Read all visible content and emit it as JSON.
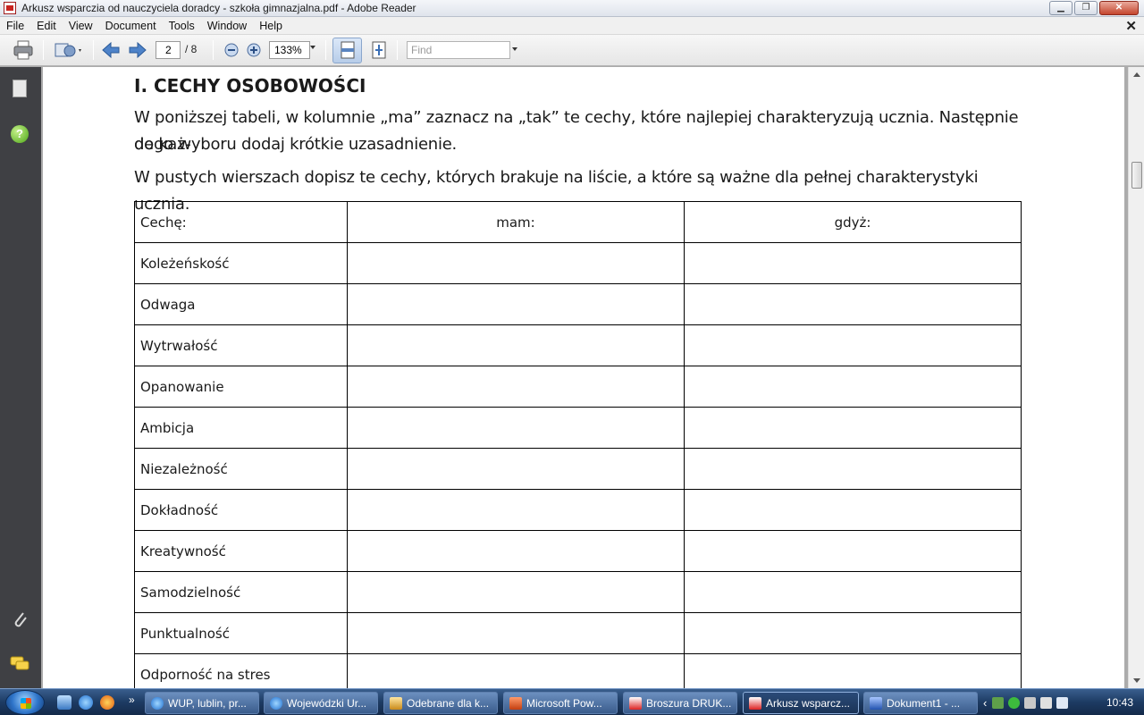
{
  "window": {
    "title": "Arkusz wsparczia od nauczyciela doradcy - szkoła gimnazjalna.pdf - Adobe Reader",
    "controls": [
      "minimize",
      "restore",
      "close"
    ]
  },
  "menu": [
    "File",
    "Edit",
    "View",
    "Document",
    "Tools",
    "Window",
    "Help"
  ],
  "toolbar": {
    "page_current": "2",
    "page_total": "/ 8",
    "zoom": "133%",
    "find_placeholder": "Find",
    "icons": [
      "print-icon",
      "stamp-icon",
      "prev-page-icon",
      "next-page-icon",
      "zoom-out-icon",
      "zoom-in-icon",
      "fit-width-icon",
      "fit-page-icon"
    ]
  },
  "navpanel": {
    "icons": [
      "pages-icon",
      "help-icon",
      "attachment-icon",
      "comments-icon"
    ]
  },
  "document": {
    "heading": "I. CECHY OSOBOWOŚCI",
    "paragraph1_line1": "W poniższej tabeli, w kolumnie „ma” zaznacz na „tak” te cechy, które najlepiej charakteryzują ucznia. Następnie do każ-",
    "paragraph1_line2": "dego wyboru dodaj krótkie uzasadnienie.",
    "paragraph2": "W pustych wierszach dopisz te cechy, których brakuje na liście, a które są ważne dla pełnej charakterystyki ucznia.",
    "table": {
      "headers": [
        "Cechę:",
        "mam:",
        "gdyż:"
      ],
      "rows": [
        [
          "Koleżeńskość",
          "",
          ""
        ],
        [
          "Odwaga",
          "",
          ""
        ],
        [
          "Wytrwałość",
          "",
          ""
        ],
        [
          "Opanowanie",
          "",
          ""
        ],
        [
          "Ambicja",
          "",
          ""
        ],
        [
          "Niezależność",
          "",
          ""
        ],
        [
          "Dokładność",
          "",
          ""
        ],
        [
          "Kreatywność",
          "",
          ""
        ],
        [
          "Samodzielność",
          "",
          ""
        ],
        [
          "Punktualność",
          "",
          ""
        ],
        [
          "Odporność na stres",
          "",
          ""
        ]
      ]
    }
  },
  "taskbar": {
    "tasks": [
      "WUP, lublin, pr...",
      "Wojewódzki Ur...",
      "Odebrane dla k...",
      "Microsoft Pow...",
      "Broszura DRUK...",
      "Arkusz wsparcz...",
      "Dokument1 - ..."
    ],
    "active_task": "Arkusz wsparcz...",
    "clock": "10:43",
    "overflow": "»",
    "tray_chevron": "‹"
  }
}
